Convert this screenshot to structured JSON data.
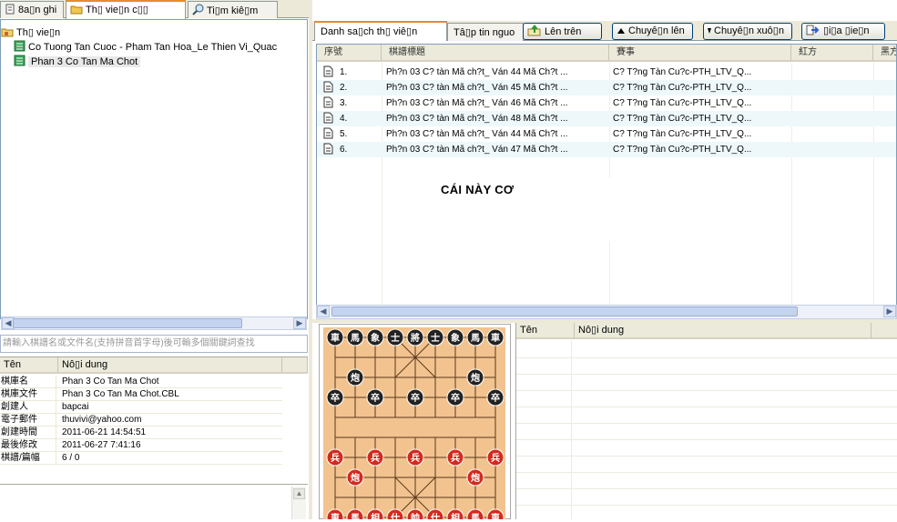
{
  "top_tabs": [
    {
      "label": "8a▯n ghi",
      "icon": "notes-icon"
    },
    {
      "label": "Th▯ vie▯n c▯▯",
      "icon": "folder-icon"
    },
    {
      "label": "Ti▯m kiê▯m",
      "icon": "search-icon"
    }
  ],
  "tree": {
    "root_label": "Th▯ vie▯n",
    "items": [
      "Co Tuong Tan Cuoc - Pham Tan Hoa_Le Thien Vi_Quac",
      "Phan 3 Co Tan Ma Chot"
    ]
  },
  "search_placeholder": "請輸入棋譜名或文件名(支持拼音首字母)後可輸多個關鍵詞查找",
  "props": {
    "col_name": "Tên",
    "col_value": "Nô▯i dung",
    "rows": [
      {
        "k": "棋庫名",
        "v": "Phan 3 Co Tan Ma Chot"
      },
      {
        "k": "棋庫文件",
        "v": "Phan 3 Co Tan Ma Chot.CBL"
      },
      {
        "k": "創建人",
        "v": "bapcai"
      },
      {
        "k": "電子郵件",
        "v": "thuvivi@yahoo.com"
      },
      {
        "k": "創建時間",
        "v": "2011-06-21 14:54:51"
      },
      {
        "k": "最後修改",
        "v": "2011-06-27 7:41:16"
      },
      {
        "k": "棋譜/篇幅",
        "v": "6 / 0"
      }
    ]
  },
  "right_tabs": [
    "Danh sa▯ch th▯ viê▯n",
    "Tâ▯p tin nguo"
  ],
  "toolbar": {
    "up_top": "Lên trên",
    "move_up": "Chuyê▯n lên",
    "move_down": "Chuyê▯n xuô▯n",
    "export": "▯i▯a ▯ie▯n"
  },
  "list": {
    "headers": [
      "序號",
      "棋譜標題",
      "賽事",
      "紅方",
      "黑方"
    ],
    "rows": [
      {
        "n": "1.",
        "title": "Ph?n 03 C? tàn Mã ch?t_ Ván 44 Mã Ch?t ...",
        "event": "C? T?ng Tàn Cu?c-PTH_LTV_Q..."
      },
      {
        "n": "2.",
        "title": "Ph?n 03 C? tàn Mã ch?t_ Ván 45 Mã Ch?t ...",
        "event": "C? T?ng Tàn Cu?c-PTH_LTV_Q..."
      },
      {
        "n": "3.",
        "title": "Ph?n 03 C? tàn Mã ch?t_ Ván 46 Mã Ch?t ...",
        "event": "C? T?ng Tàn Cu?c-PTH_LTV_Q..."
      },
      {
        "n": "4.",
        "title": "Ph?n 03 C? tàn Mã ch?t_ Ván 48 Mã Ch?t ...",
        "event": "C? T?ng Tàn Cu?c-PTH_LTV_Q..."
      },
      {
        "n": "5.",
        "title": "Ph?n 03 C? tàn Mã ch?t_ Ván 44 Mã Ch?t ...",
        "event": "C? T?ng Tàn Cu?c-PTH_LTV_Q..."
      },
      {
        "n": "6.",
        "title": "Ph?n 03 C? tàn Mã ch?t_ Ván 47 Mã Ch?t ...",
        "event": "C? T?ng Tàn Cu?c-PTH_LTV_Q..."
      }
    ]
  },
  "overlay_text": "CÁI NÀY CƠ",
  "bottom_grid": {
    "col_name": "Tên",
    "col_value": "Nô▯i dung"
  },
  "board": {
    "black_top": [
      "車",
      "馬",
      "象",
      "士",
      "將",
      "士",
      "象",
      "馬",
      "車"
    ],
    "black_cannon": "炮",
    "black_pawn": "卒",
    "red_pawn": "兵",
    "red_cannon": "炮",
    "red_bottom": [
      "車",
      "馬",
      "相",
      "仕",
      "帥",
      "仕",
      "相",
      "馬",
      "車"
    ]
  },
  "colors": {
    "tab_accent": "#e68b2c",
    "row_alt": "#eef8fb",
    "board": "#f2c38f",
    "red_piece": "#d42a1e",
    "black_piece": "#222222"
  }
}
